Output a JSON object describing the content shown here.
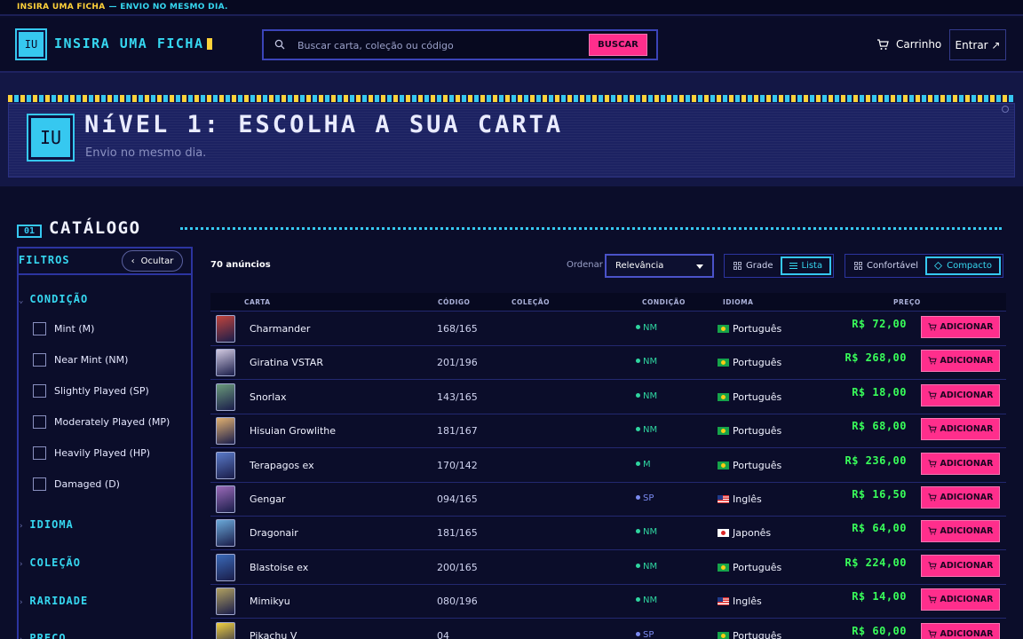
{
  "topstrip": {
    "brand": "INSIRA UMA FICHA",
    "tagline": "— ENVIO NO MESMO DIA."
  },
  "header": {
    "logo_initials": "IU",
    "logo_text": "INSIRA UMA FICHA",
    "search_placeholder": "Buscar carta, coleção ou código",
    "search_button": "BUSCAR",
    "cart_label": "Carrinho",
    "login_label": "Entrar ↗"
  },
  "hero": {
    "logo_initials": "IU",
    "title": "NíVEL 1: ESCOLHA A SUA CARTA",
    "subtitle": "Envio no mesmo dia."
  },
  "section": {
    "number": "01",
    "title": "CATÁLOGO"
  },
  "sidebar": {
    "title": "FILTROS",
    "hide_label": "Ocultar",
    "condition_title": "CONDIÇÃO",
    "conditions": [
      "Mint (M)",
      "Near Mint (NM)",
      "Slightly Played (SP)",
      "Moderately Played (MP)",
      "Heavily Played (HP)",
      "Damaged (D)"
    ],
    "facets": [
      "IDIOMA",
      "COLEÇÃO",
      "RARIDADE",
      "PREÇO"
    ]
  },
  "toolbar": {
    "count": "70 anúncios",
    "order_label": "Ordenar",
    "order_value": "Relevância",
    "view_grid": "Grade",
    "view_list": "Lista",
    "density_comfortable": "Confortável",
    "density_compact": "Compacto"
  },
  "table": {
    "headers": {
      "card": "CARTA",
      "code": "CÓDIGO",
      "collection": "COLEÇÃO",
      "condition": "CONDIÇÃO",
      "language": "IDIOMA",
      "price": "PREÇO"
    },
    "add_label": "ADICIONAR",
    "rows": [
      {
        "name": "Charmander",
        "code": "168/165",
        "condition": "NM",
        "language": "Português",
        "price": "R$ 72,00"
      },
      {
        "name": "Giratina VSTAR",
        "code": "201/196",
        "condition": "NM",
        "language": "Português",
        "price": "R$ 268,00"
      },
      {
        "name": "Snorlax",
        "code": "143/165",
        "condition": "NM",
        "language": "Português",
        "price": "R$ 18,00"
      },
      {
        "name": "Hisuian Growlithe",
        "code": "181/167",
        "condition": "NM",
        "language": "Português",
        "price": "R$ 68,00"
      },
      {
        "name": "Terapagos ex",
        "code": "170/142",
        "condition": "M",
        "language": "Português",
        "price": "R$ 236,00"
      },
      {
        "name": "Gengar",
        "code": "094/165",
        "condition": "SP",
        "language": "Inglês",
        "price": "R$ 16,50"
      },
      {
        "name": "Dragonair",
        "code": "181/165",
        "condition": "NM",
        "language": "Japonês",
        "price": "R$ 64,00"
      },
      {
        "name": "Blastoise ex",
        "code": "200/165",
        "condition": "NM",
        "language": "Português",
        "price": "R$ 224,00"
      },
      {
        "name": "Mimikyu",
        "code": "080/196",
        "condition": "NM",
        "language": "Inglês",
        "price": "R$ 14,00"
      },
      {
        "name": "Pikachu V",
        "code": "04",
        "condition": "SP",
        "language": "Português",
        "price": "R$ 60,00"
      }
    ]
  },
  "colors": {
    "accent_cyan": "#36d7f0",
    "accent_pink": "#ff2e8c",
    "accent_yellow": "#ffd23a",
    "price_green": "#39ff5a",
    "background": "#0b0d2a"
  }
}
